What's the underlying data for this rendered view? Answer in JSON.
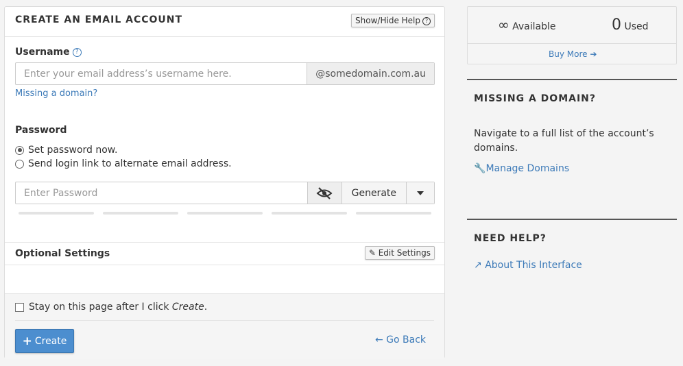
{
  "panel": {
    "title": "CREATE AN EMAIL ACCOUNT",
    "help_button": "Show/Hide Help",
    "username_label": "Username",
    "username_placeholder": "Enter your email address’s username here.",
    "domain_suffix": "@somedomain.com.au",
    "missing_domain_link": "Missing a domain?",
    "password_label": "Password",
    "radio_set_now": "Set password now.",
    "radio_send_link": "Send login link to alternate email address.",
    "password_placeholder": "Enter Password",
    "generate_label": "Generate",
    "optional_settings": "Optional Settings",
    "edit_settings": "Edit Settings",
    "stay_text_pre": "Stay on this page after I click ",
    "stay_text_em": "Create",
    "stay_text_post": ".",
    "create_label": "Create",
    "go_back": "Go Back"
  },
  "stats": {
    "available_value": "∞",
    "available_label": "Available",
    "used_value": "0",
    "used_label": "Used",
    "buy_more": "Buy More"
  },
  "missing_domain": {
    "title": "MISSING A DOMAIN?",
    "text": "Navigate to a full list of the account’s domains.",
    "link": "Manage Domains"
  },
  "need_help": {
    "title": "NEED HELP?",
    "link": "About This Interface"
  },
  "colors": {
    "accent": "#4c8ecf",
    "link": "#3c7ab8"
  }
}
